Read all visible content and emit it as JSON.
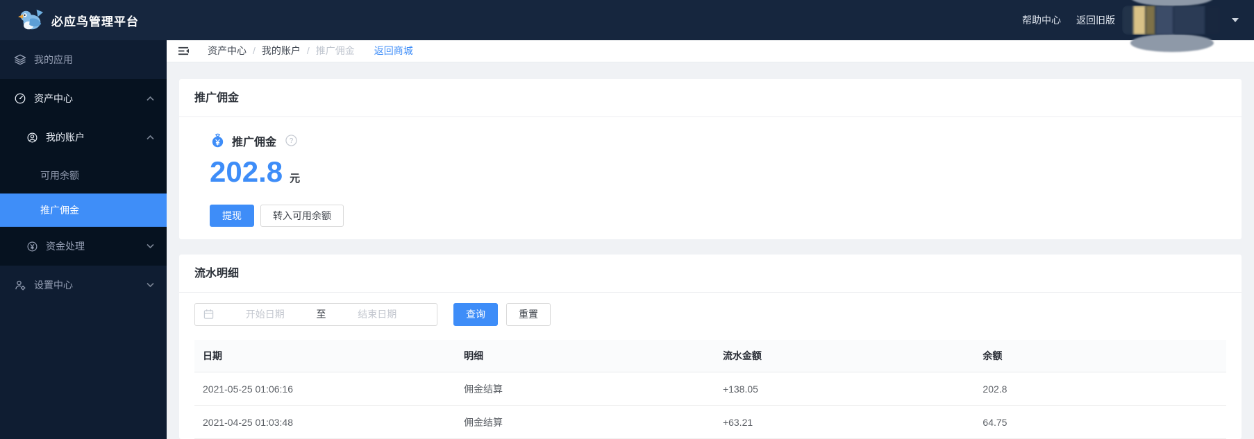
{
  "header": {
    "app_title": "必应鸟管理平台",
    "help_link": "帮助中心",
    "back_old_link": "返回旧版"
  },
  "sidebar": {
    "items": [
      {
        "label": "我的应用"
      },
      {
        "label": "资产中心"
      },
      {
        "label": "我的账户"
      },
      {
        "label": "可用余额"
      },
      {
        "label": "推广佣金"
      },
      {
        "label": "资金处理"
      },
      {
        "label": "设置中心"
      }
    ]
  },
  "breadcrumb": {
    "items": [
      "资产中心",
      "我的账户",
      "推广佣金"
    ],
    "separator": "/",
    "back_link": "返回商城"
  },
  "commission_card": {
    "title": "推广佣金",
    "stat_label": "推广佣金",
    "amount": "202.8",
    "unit": "元",
    "withdraw_button": "提现",
    "transfer_button": "转入可用余额"
  },
  "details_card": {
    "title": "流水明细",
    "filter": {
      "start_placeholder": "开始日期",
      "separator": "至",
      "end_placeholder": "结束日期",
      "query_button": "查询",
      "reset_button": "重置"
    },
    "table": {
      "headers": [
        "日期",
        "明细",
        "流水金额",
        "余额"
      ],
      "rows": [
        [
          "2021-05-25 01:06:16",
          "佣金结算",
          "+138.05",
          "202.8"
        ],
        [
          "2021-04-25 01:03:48",
          "佣金结算",
          "+63.21",
          "64.75"
        ]
      ]
    }
  },
  "icons": {
    "bird-logo": "blue bird mascot",
    "layers-icon": "stacked layers",
    "dashboard-icon": "speedometer",
    "user-circle-icon": "person in circle",
    "yen-circle-icon": "¥ in circle",
    "user-gear-icon": "person with gear",
    "menu-fold-icon": "collapse menu ☰◄",
    "purse-icon": "blue money pouch ¥",
    "question-circle-icon": "?",
    "calendar-icon": "calendar",
    "caret-down-icon": "▼",
    "chevron-up-icon": "⌃",
    "chevron-down-icon": "⌄"
  },
  "colors": {
    "accent_blue": "#3e8df8",
    "header_bg": "#16263e",
    "sidebar_bg": "#0f1d32",
    "submenu_bg": "#061220",
    "selected_item_bg": "#3f8ef8",
    "content_bg": "#f0f2f5"
  }
}
